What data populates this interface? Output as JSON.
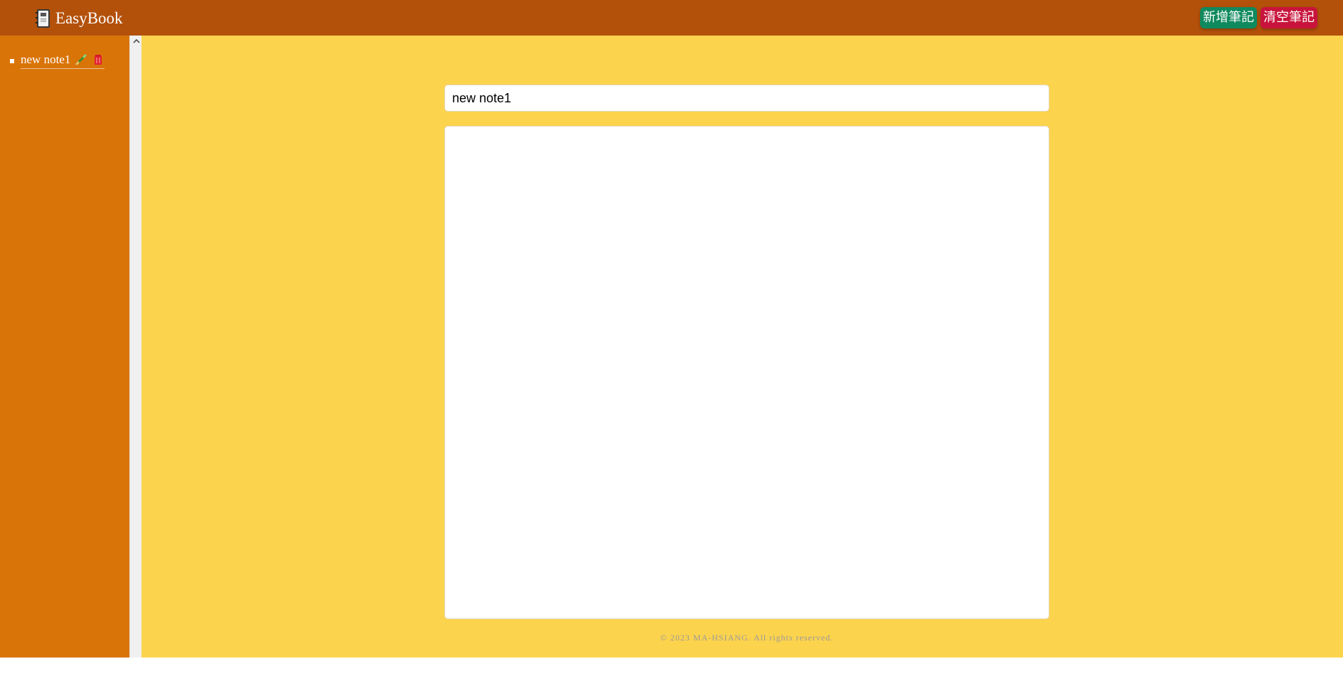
{
  "app": {
    "title": "EasyBook",
    "icon": "notebook-icon"
  },
  "header": {
    "add_note_label": "新增筆記",
    "clear_notes_label": "清空筆記",
    "add_color": "#0f8a5f",
    "clear_color": "#c8143c",
    "bg_color": "#b3510b"
  },
  "sidebar": {
    "bg_color": "#d97408",
    "notes": [
      {
        "label": "new note1",
        "edit_icon": "pencil-icon",
        "delete_icon": "trash-icon"
      }
    ]
  },
  "editor": {
    "title_value": "new note1",
    "content_value": "",
    "bg_color": "#fcd34d"
  },
  "footer": {
    "text": "© 2023 MA-HSIANG. All rights reserved."
  }
}
